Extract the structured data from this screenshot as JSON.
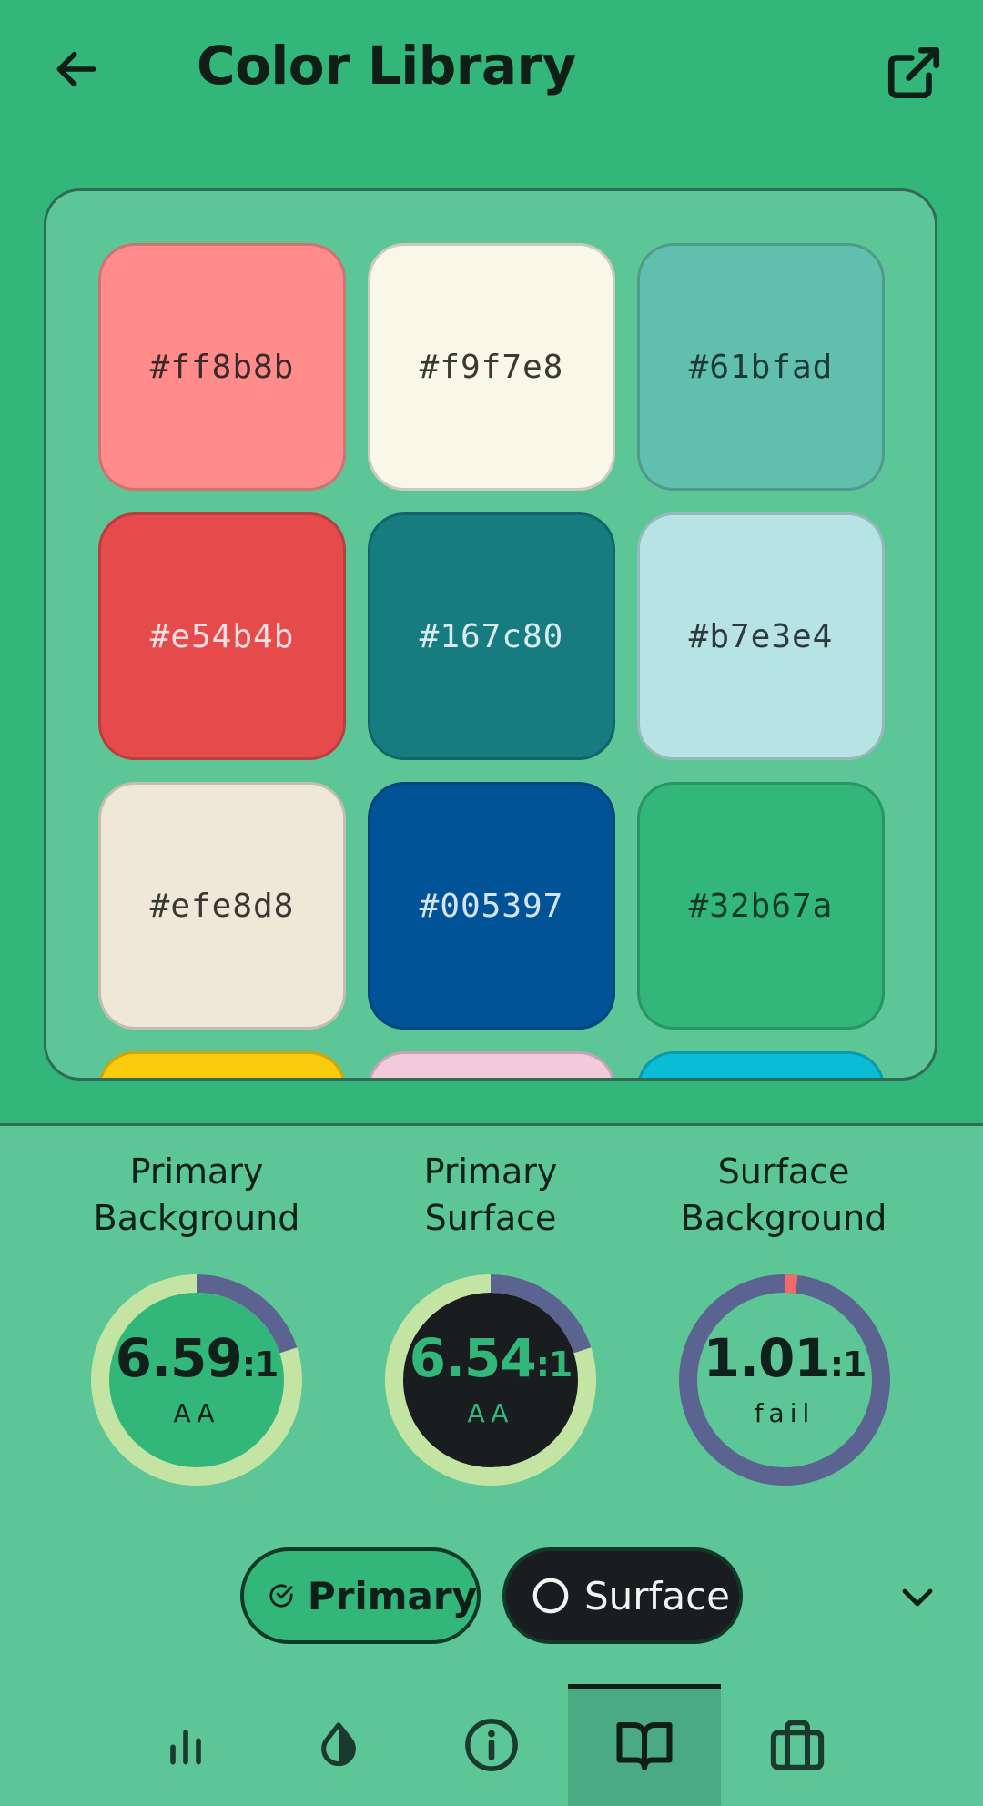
{
  "header": {
    "title": "Color Library"
  },
  "swatches": [
    {
      "hex": "#ff8b8b",
      "label": "#ff8b8b",
      "text_color": "#3a2a2a"
    },
    {
      "hex": "#f9f7e8",
      "label": "#f9f7e8",
      "text_color": "#3a3a33"
    },
    {
      "hex": "#61bfad",
      "label": "#61bfad",
      "text_color": "#1e3a35"
    },
    {
      "hex": "#e54b4b",
      "label": "#e54b4b",
      "text_color": "#f4dede"
    },
    {
      "hex": "#167c80",
      "label": "#167c80",
      "text_color": "#d8eced"
    },
    {
      "hex": "#b7e3e4",
      "label": "#b7e3e4",
      "text_color": "#2d3b3c"
    },
    {
      "hex": "#efe8d8",
      "label": "#efe8d8",
      "text_color": "#3a3833"
    },
    {
      "hex": "#005397",
      "label": "#005397",
      "text_color": "#d6e3f0"
    },
    {
      "hex": "#32b67a",
      "label": "#32b67a",
      "text_color": "#143a28"
    },
    {
      "hex": "#facb0c",
      "label": "",
      "text_color": "#3a3000"
    },
    {
      "hex": "#f3cadc",
      "label": "",
      "text_color": "#3a3036"
    },
    {
      "hex": "#0bbcd6",
      "label": "",
      "text_color": "#053a42"
    }
  ],
  "contrast": [
    {
      "label_line1": "Primary",
      "label_line2": "Background",
      "ratio": "6.59",
      "suffix": ":1",
      "grade": "AA",
      "ring_bg": "#c4e4a4",
      "ring_fg": "#5b6490",
      "fill": "#32b67a",
      "text": "#10201a",
      "grade_color": "#10201a",
      "fraction": 0.2
    },
    {
      "label_line1": "Primary",
      "label_line2": "Surface",
      "ratio": "6.54",
      "suffix": ":1",
      "grade": "AA",
      "ring_bg": "#c4e4a4",
      "ring_fg": "#5b6490",
      "fill": "#1a1d1f",
      "text": "#32b67a",
      "grade_color": "#32b67a",
      "fraction": 0.2
    },
    {
      "label_line1": "Surface",
      "label_line2": "Background",
      "ratio": "1.01",
      "suffix": ":1",
      "grade": "fail",
      "ring_bg": "#5b6490",
      "ring_fg": "#f06a6a",
      "fill": "#5cc697",
      "text": "#10201a",
      "grade_color": "#10201a",
      "fraction": 0.02
    }
  ],
  "chips": {
    "primary_label": "Primary",
    "surface_label": "Surface"
  },
  "nav": {
    "items": [
      {
        "icon": "bar-chart-icon",
        "active": false
      },
      {
        "icon": "contrast-drop-icon",
        "active": false
      },
      {
        "icon": "info-icon",
        "active": false
      },
      {
        "icon": "book-icon",
        "active": true
      },
      {
        "icon": "briefcase-icon",
        "active": false
      }
    ]
  },
  "colors": {
    "background": "#32b67a",
    "panel": "#5cc697",
    "dark": "#1a1d1f",
    "border": "#2f6b55"
  }
}
